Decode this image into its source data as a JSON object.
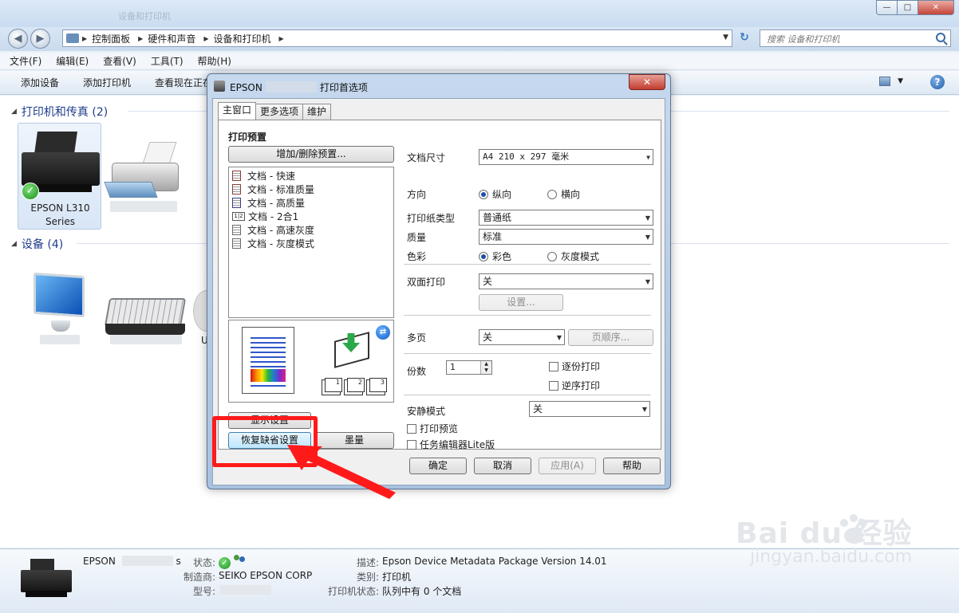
{
  "window": {
    "title_dim": "设备和打印机",
    "minimize": "—",
    "maximize": "□",
    "close": "✕"
  },
  "address": {
    "crumbs": [
      "控制面板",
      "硬件和声音",
      "设备和打印机"
    ],
    "search_placeholder": "搜索 设备和打印机"
  },
  "menu": [
    "文件(F)",
    "编辑(E)",
    "查看(V)",
    "工具(T)",
    "帮助(H)"
  ],
  "commands": [
    "添加设备",
    "添加打印机",
    "查看现在正在"
  ],
  "groups": {
    "printers": "打印机和传真 (2)",
    "devices": "设备 (4)"
  },
  "printer_selected": {
    "line1": "EPSON L310",
    "line2": "Series"
  },
  "device_partial_label": "U",
  "details": {
    "name_prefix": "EPSON",
    "name_suffix": "s",
    "status_label": "状态:",
    "manufacturer_label": "制造商:",
    "manufacturer": "SEIKO EPSON CORP",
    "model_label": "型号:",
    "description_label": "描述:",
    "description": "Epson Device Metadata Package Version 14.01",
    "category_label": "类别:",
    "category": "打印机",
    "printer_status_label": "打印机状态:",
    "printer_status": "队列中有 0 个文档"
  },
  "dialog": {
    "title_prefix": "EPSON",
    "title_suffix": "打印首选项",
    "close": "✕",
    "tabs": [
      "主窗口",
      "更多选项",
      "维护"
    ],
    "presets_label": "打印预置",
    "add_delete_presets": "增加/删除预置...",
    "presets": [
      {
        "label": "文档 - 快速",
        "icon": "document-icon"
      },
      {
        "label": "文档 - 标准质量",
        "icon": "document-icon"
      },
      {
        "label": "文档 - 高质量",
        "icon": "document-icon"
      },
      {
        "label": "文档 - 2合1",
        "icon": "two-in-one-icon"
      },
      {
        "label": "文档 - 高速灰度",
        "icon": "document-icon"
      },
      {
        "label": "文档 - 灰度模式",
        "icon": "document-icon"
      }
    ],
    "preview_sheets": [
      "1",
      "2",
      "3"
    ],
    "show_settings": "显示设置",
    "restore_defaults": "恢复缺省设置",
    "ink_levels": "墨量",
    "paper_size_label": "文档尺寸",
    "paper_size": "A4 210 x 297 毫米",
    "orientation_label": "方向",
    "portrait": "纵向",
    "landscape": "横向",
    "paper_type_label": "打印纸类型",
    "paper_type": "普通纸",
    "quality_label": "质量",
    "quality": "标准",
    "color_label": "色彩",
    "color": "彩色",
    "grayscale": "灰度模式",
    "duplex_label": "双面打印",
    "duplex": "关",
    "duplex_settings": "设置...",
    "multipage_label": "多页",
    "multipage": "关",
    "page_order": "页顺序...",
    "copies_label": "份数",
    "copies": "1",
    "collate": "逐份打印",
    "reverse": "逆序打印",
    "quiet_mode_label": "安静模式",
    "quiet_mode": "关",
    "print_preview": "打印预览",
    "job_arranger": "任务编辑器Lite版",
    "ok": "确定",
    "cancel": "取消",
    "apply": "应用(A)",
    "help": "帮助"
  },
  "watermark": {
    "brand": "Bai  du 经验",
    "url": "jingyan.baidu.com"
  },
  "colors": {
    "annotation_red": "#ff1a1a",
    "group_title_blue": "#1e3c8c"
  }
}
